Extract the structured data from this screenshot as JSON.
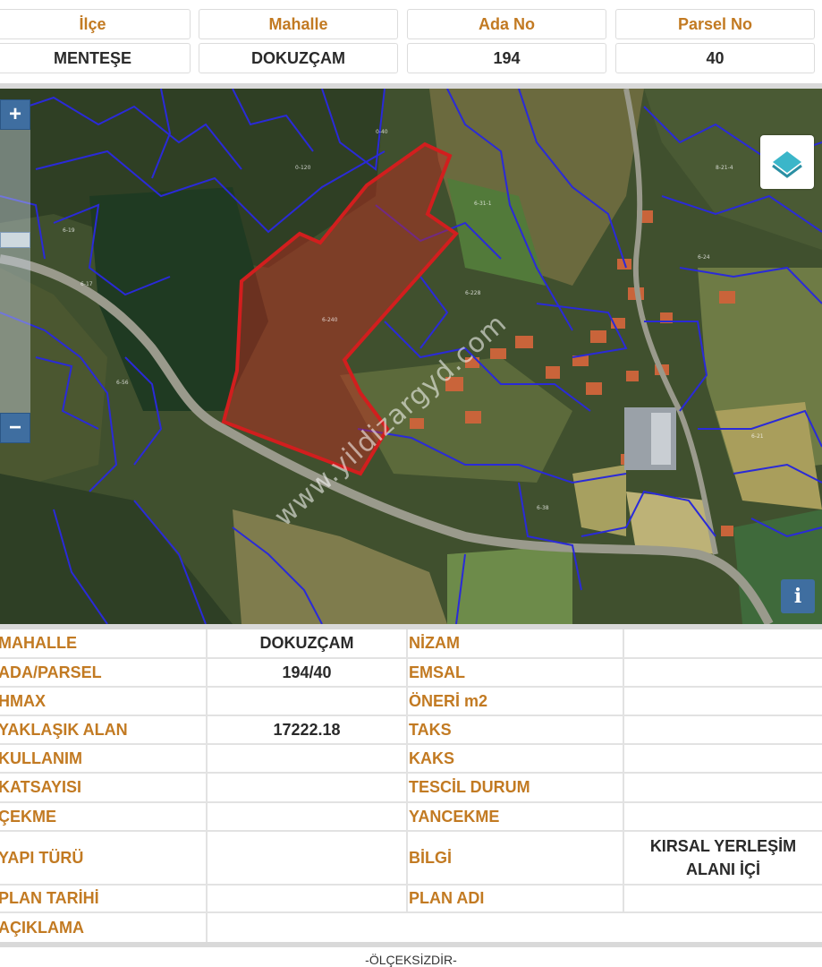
{
  "header": {
    "ilce_label": "İlçe",
    "mahalle_label": "Mahalle",
    "ada_label": "Ada No",
    "parsel_label": "Parsel No",
    "ilce_value": "MENTEŞE",
    "mahalle_value": "DOKUZÇAM",
    "ada_value": "194",
    "parsel_value": "40"
  },
  "map": {
    "zoom_in": "+",
    "zoom_out": "−",
    "info": "i",
    "watermark": "www.yildizargyd.com",
    "parcel_outline_color": "#d21e1e",
    "boundary_color": "#2a2ad8"
  },
  "details": {
    "rows": [
      {
        "k1": "MAHALLE",
        "v1": "DOKUZÇAM",
        "k2": "NİZAM",
        "v2": ""
      },
      {
        "k1": "ADA/PARSEL",
        "v1": "194/40",
        "k2": "EMSAL",
        "v2": ""
      },
      {
        "k1": "HMAX",
        "v1": "",
        "k2": "ÖNERİ m2",
        "v2": ""
      },
      {
        "k1": "YAKLAŞIK ALAN",
        "v1": "17222.18",
        "k2": "TAKS",
        "v2": ""
      },
      {
        "k1": "KULLANIM",
        "v1": "",
        "k2": "KAKS",
        "v2": ""
      },
      {
        "k1": "KATSAYISI",
        "v1": "",
        "k2": "TESCİL DURUM",
        "v2": ""
      },
      {
        "k1": "ÇEKME",
        "v1": "",
        "k2": "YANCEKME",
        "v2": ""
      },
      {
        "k1": "YAPI TÜRÜ",
        "v1": "",
        "k2": "BİLGİ",
        "v2": "KIRSAL YERLEŞİM ALANI İÇİ"
      },
      {
        "k1": "PLAN TARİHİ",
        "v1": "",
        "k2": "PLAN ADI",
        "v2": ""
      },
      {
        "k1": "AÇIKLAMA",
        "v1": "",
        "k2": "",
        "v2": ""
      }
    ]
  },
  "footer": {
    "scale_note": "-ÖLÇEKSİZDİR-"
  }
}
